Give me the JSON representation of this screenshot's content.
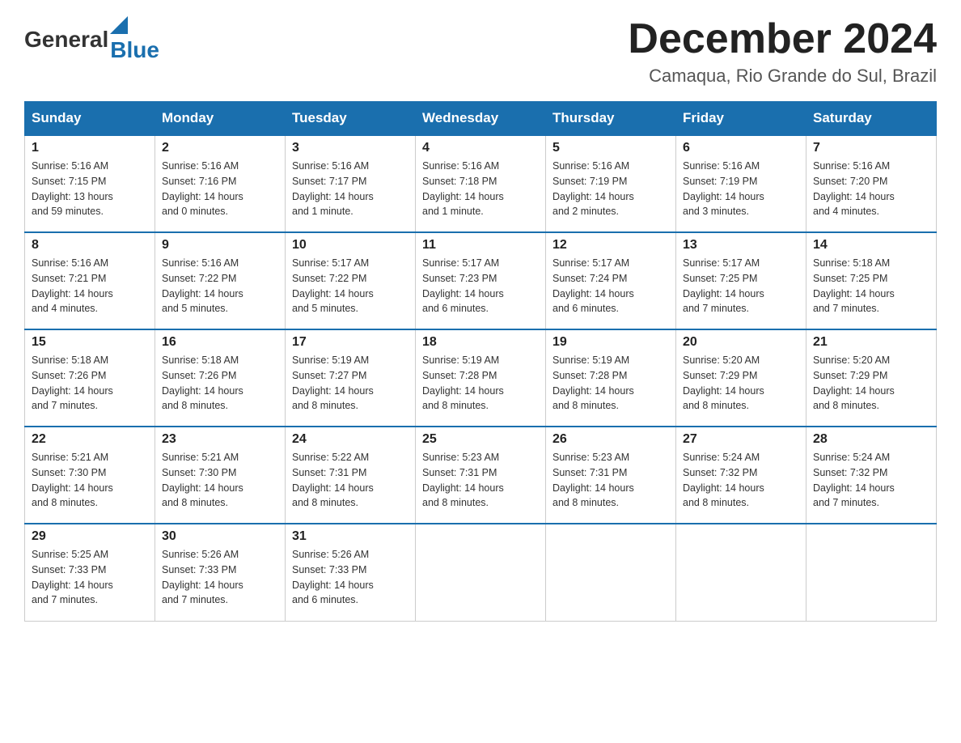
{
  "header": {
    "logo_general": "General",
    "logo_blue": "Blue",
    "title": "December 2024",
    "location": "Camaqua, Rio Grande do Sul, Brazil"
  },
  "weekdays": [
    "Sunday",
    "Monday",
    "Tuesday",
    "Wednesday",
    "Thursday",
    "Friday",
    "Saturday"
  ],
  "weeks": [
    [
      {
        "day": "1",
        "sunrise": "5:16 AM",
        "sunset": "7:15 PM",
        "daylight": "13 hours and 59 minutes."
      },
      {
        "day": "2",
        "sunrise": "5:16 AM",
        "sunset": "7:16 PM",
        "daylight": "14 hours and 0 minutes."
      },
      {
        "day": "3",
        "sunrise": "5:16 AM",
        "sunset": "7:17 PM",
        "daylight": "14 hours and 1 minute."
      },
      {
        "day": "4",
        "sunrise": "5:16 AM",
        "sunset": "7:18 PM",
        "daylight": "14 hours and 1 minute."
      },
      {
        "day": "5",
        "sunrise": "5:16 AM",
        "sunset": "7:19 PM",
        "daylight": "14 hours and 2 minutes."
      },
      {
        "day": "6",
        "sunrise": "5:16 AM",
        "sunset": "7:19 PM",
        "daylight": "14 hours and 3 minutes."
      },
      {
        "day": "7",
        "sunrise": "5:16 AM",
        "sunset": "7:20 PM",
        "daylight": "14 hours and 4 minutes."
      }
    ],
    [
      {
        "day": "8",
        "sunrise": "5:16 AM",
        "sunset": "7:21 PM",
        "daylight": "14 hours and 4 minutes."
      },
      {
        "day": "9",
        "sunrise": "5:16 AM",
        "sunset": "7:22 PM",
        "daylight": "14 hours and 5 minutes."
      },
      {
        "day": "10",
        "sunrise": "5:17 AM",
        "sunset": "7:22 PM",
        "daylight": "14 hours and 5 minutes."
      },
      {
        "day": "11",
        "sunrise": "5:17 AM",
        "sunset": "7:23 PM",
        "daylight": "14 hours and 6 minutes."
      },
      {
        "day": "12",
        "sunrise": "5:17 AM",
        "sunset": "7:24 PM",
        "daylight": "14 hours and 6 minutes."
      },
      {
        "day": "13",
        "sunrise": "5:17 AM",
        "sunset": "7:25 PM",
        "daylight": "14 hours and 7 minutes."
      },
      {
        "day": "14",
        "sunrise": "5:18 AM",
        "sunset": "7:25 PM",
        "daylight": "14 hours and 7 minutes."
      }
    ],
    [
      {
        "day": "15",
        "sunrise": "5:18 AM",
        "sunset": "7:26 PM",
        "daylight": "14 hours and 7 minutes."
      },
      {
        "day": "16",
        "sunrise": "5:18 AM",
        "sunset": "7:26 PM",
        "daylight": "14 hours and 8 minutes."
      },
      {
        "day": "17",
        "sunrise": "5:19 AM",
        "sunset": "7:27 PM",
        "daylight": "14 hours and 8 minutes."
      },
      {
        "day": "18",
        "sunrise": "5:19 AM",
        "sunset": "7:28 PM",
        "daylight": "14 hours and 8 minutes."
      },
      {
        "day": "19",
        "sunrise": "5:19 AM",
        "sunset": "7:28 PM",
        "daylight": "14 hours and 8 minutes."
      },
      {
        "day": "20",
        "sunrise": "5:20 AM",
        "sunset": "7:29 PM",
        "daylight": "14 hours and 8 minutes."
      },
      {
        "day": "21",
        "sunrise": "5:20 AM",
        "sunset": "7:29 PM",
        "daylight": "14 hours and 8 minutes."
      }
    ],
    [
      {
        "day": "22",
        "sunrise": "5:21 AM",
        "sunset": "7:30 PM",
        "daylight": "14 hours and 8 minutes."
      },
      {
        "day": "23",
        "sunrise": "5:21 AM",
        "sunset": "7:30 PM",
        "daylight": "14 hours and 8 minutes."
      },
      {
        "day": "24",
        "sunrise": "5:22 AM",
        "sunset": "7:31 PM",
        "daylight": "14 hours and 8 minutes."
      },
      {
        "day": "25",
        "sunrise": "5:23 AM",
        "sunset": "7:31 PM",
        "daylight": "14 hours and 8 minutes."
      },
      {
        "day": "26",
        "sunrise": "5:23 AM",
        "sunset": "7:31 PM",
        "daylight": "14 hours and 8 minutes."
      },
      {
        "day": "27",
        "sunrise": "5:24 AM",
        "sunset": "7:32 PM",
        "daylight": "14 hours and 8 minutes."
      },
      {
        "day": "28",
        "sunrise": "5:24 AM",
        "sunset": "7:32 PM",
        "daylight": "14 hours and 7 minutes."
      }
    ],
    [
      {
        "day": "29",
        "sunrise": "5:25 AM",
        "sunset": "7:33 PM",
        "daylight": "14 hours and 7 minutes."
      },
      {
        "day": "30",
        "sunrise": "5:26 AM",
        "sunset": "7:33 PM",
        "daylight": "14 hours and 7 minutes."
      },
      {
        "day": "31",
        "sunrise": "5:26 AM",
        "sunset": "7:33 PM",
        "daylight": "14 hours and 6 minutes."
      },
      null,
      null,
      null,
      null
    ]
  ],
  "labels": {
    "sunrise": "Sunrise:",
    "sunset": "Sunset:",
    "daylight": "Daylight:"
  }
}
